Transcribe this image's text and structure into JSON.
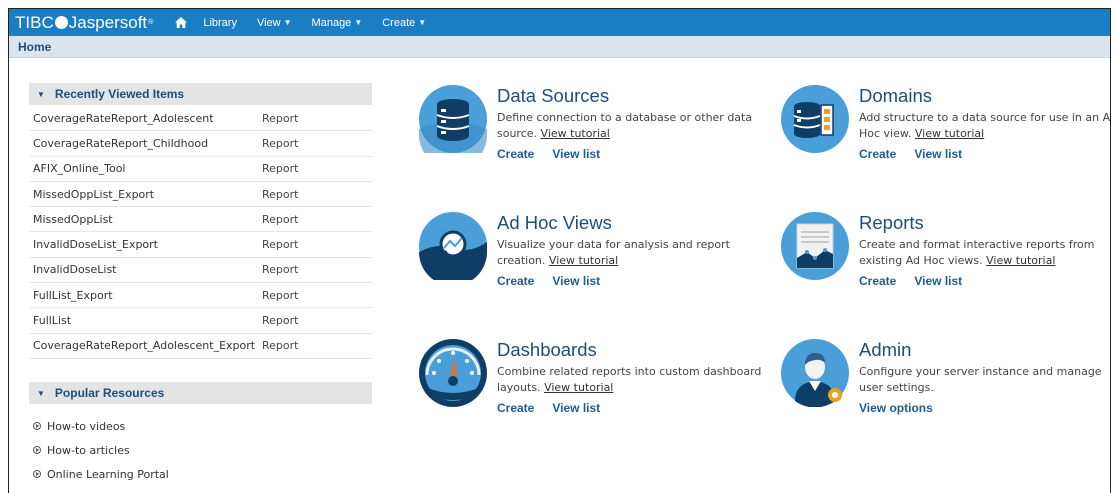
{
  "brand": {
    "tibco": "TIBC",
    "jaspersoft": "Jaspersoft",
    "tm": "®"
  },
  "nav": {
    "library": "Library",
    "view": "View",
    "manage": "Manage",
    "create": "Create"
  },
  "breadcrumb": "Home",
  "recent": {
    "title": "Recently Viewed Items",
    "items": [
      {
        "name": "CoverageRateReport_Adolescent",
        "type": "Report"
      },
      {
        "name": "CoverageRateReport_Childhood",
        "type": "Report"
      },
      {
        "name": "AFIX_Online_Tool",
        "type": "Report"
      },
      {
        "name": "MissedOppList_Export",
        "type": "Report"
      },
      {
        "name": "MissedOppList",
        "type": "Report"
      },
      {
        "name": "InvalidDoseList_Export",
        "type": "Report"
      },
      {
        "name": "InvalidDoseList",
        "type": "Report"
      },
      {
        "name": "FullList_Export",
        "type": "Report"
      },
      {
        "name": "FullList",
        "type": "Report"
      },
      {
        "name": "CoverageRateReport_Adolescent_Export",
        "type": "Report"
      }
    ]
  },
  "popular": {
    "title": "Popular Resources",
    "items": [
      "How-to videos",
      "How-to articles",
      "Online Learning Portal"
    ]
  },
  "cards": {
    "datasources": {
      "title": "Data Sources",
      "desc": "Define connection to a database or other data source.",
      "tutorial": "View tutorial",
      "create": "Create",
      "list": "View list"
    },
    "domains": {
      "title": "Domains",
      "desc": "Add structure to a data source for use in an Ad Hoc view.",
      "tutorial": "View tutorial",
      "create": "Create",
      "list": "View list"
    },
    "adhoc": {
      "title": "Ad Hoc Views",
      "desc": "Visualize your data for analysis and report creation.",
      "tutorial": "View tutorial",
      "create": "Create",
      "list": "View list"
    },
    "reports": {
      "title": "Reports",
      "desc": "Create and format interactive reports from existing Ad Hoc views.",
      "tutorial": "View tutorial",
      "create": "Create",
      "list": "View list"
    },
    "dashboards": {
      "title": "Dashboards",
      "desc": "Combine related reports into custom dashboard layouts.",
      "tutorial": "View tutorial",
      "create": "Create",
      "list": "View list"
    },
    "admin": {
      "title": "Admin",
      "desc": "Configure your server instance and manage user settings.",
      "options": "View options"
    }
  },
  "colors": {
    "topbar": "#1a7ec4",
    "accent": "#1e4e79",
    "icon_circle": "#4a9fd8"
  }
}
